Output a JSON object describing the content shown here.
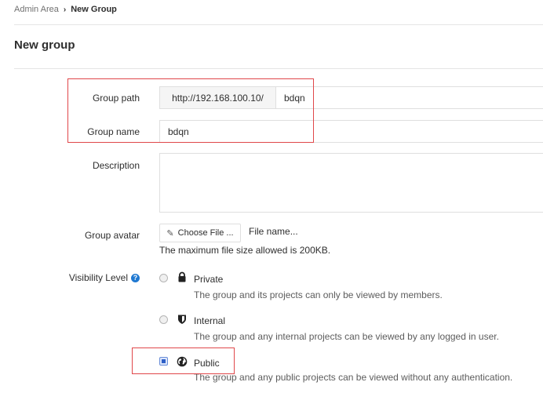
{
  "breadcrumb": {
    "root": "Admin Area",
    "current": "New Group"
  },
  "page_title": "New group",
  "form": {
    "group_path": {
      "label": "Group path",
      "prefix": "http://192.168.100.10/",
      "value": "bdqn"
    },
    "group_name": {
      "label": "Group name",
      "value": "bdqn"
    },
    "description": {
      "label": "Description",
      "value": ""
    },
    "avatar": {
      "label": "Group avatar",
      "button_label": "Choose File ...",
      "file_name": "File name...",
      "help": "The maximum file size allowed is 200KB."
    },
    "visibility": {
      "label": "Visibility Level",
      "options": [
        {
          "title": "Private",
          "description": "The group and its projects can only be viewed by members.",
          "icon": "lock-icon",
          "checked": false
        },
        {
          "title": "Internal",
          "description": "The group and any internal projects can be viewed by any logged in user.",
          "icon": "shield-icon",
          "checked": false
        },
        {
          "title": "Public",
          "description": "The group and any public projects can be viewed without any authentication.",
          "icon": "globe-icon",
          "checked": true
        }
      ]
    }
  },
  "colors": {
    "highlight": "#e0474a",
    "accent": "#1f78d1"
  }
}
